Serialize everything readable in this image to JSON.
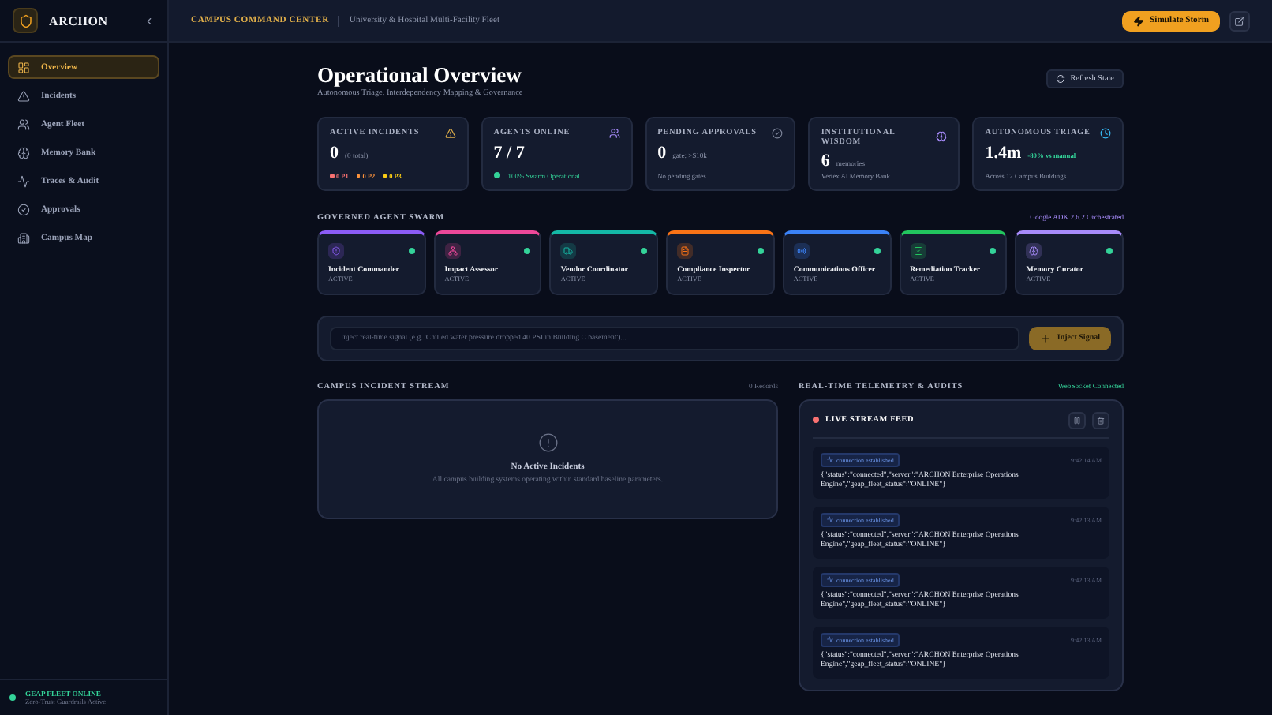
{
  "sidebar": {
    "brand": "ARCHON",
    "items": [
      {
        "label": "Overview",
        "selected": true
      },
      {
        "label": "Incidents",
        "selected": false
      },
      {
        "label": "Agent Fleet",
        "selected": false
      },
      {
        "label": "Memory Bank",
        "selected": false
      },
      {
        "label": "Traces & Audit",
        "selected": false
      },
      {
        "label": "Approvals",
        "selected": false
      },
      {
        "label": "Campus Map",
        "selected": false
      }
    ],
    "status": {
      "title": "GEAP FLEET ONLINE",
      "subtitle": "Zero-Trust Guardrails Active"
    }
  },
  "header": {
    "title": "CAMPUS COMMAND CENTER",
    "subtitle": "University & Hospital Multi-Facility Fleet",
    "action": "Simulate Storm"
  },
  "page": {
    "title": "Operational Overview",
    "subtitle": "Autonomous Triage, Interdependency Mapping & Governance",
    "refresh": "Refresh State"
  },
  "stats": [
    {
      "kind": "priorities",
      "title": "ACTIVE INCIDENTS",
      "value": "0",
      "unit": "(0 total)",
      "priorities": [
        {
          "label": "0 P1",
          "color": "#f87171"
        },
        {
          "label": "0 P2",
          "color": "#fb923c"
        },
        {
          "label": "0 P3",
          "color": "#facc15"
        }
      ]
    },
    {
      "kind": "status",
      "title": "AGENTS ONLINE",
      "value": "7 / 7",
      "note": "100% Swarm Operational"
    },
    {
      "kind": "note",
      "title": "PENDING APPROVALS",
      "value": "0",
      "unit": "gate: >$10k",
      "note": "No pending gates"
    },
    {
      "kind": "note",
      "title": "INSTITUTIONAL WISDOM",
      "value": "6",
      "unit": "memories",
      "note": "Vertex AI Memory Bank"
    },
    {
      "kind": "trend",
      "title": "AUTONOMOUS TRIAGE",
      "value": "1.4m",
      "badge": "-80% vs manual",
      "note": "Across 12 Campus Buildings"
    }
  ],
  "swarm": {
    "title": "GOVERNED AGENT SWARM",
    "tag": "Google ADK 2.6.2 Orchestrated",
    "agents": [
      {
        "name": "Incident Commander",
        "status": "ACTIVE",
        "online": true,
        "color": "#8b5cf6"
      },
      {
        "name": "Impact Assessor",
        "status": "ACTIVE",
        "online": true,
        "color": "#ec4899"
      },
      {
        "name": "Vendor Coordinator",
        "status": "ACTIVE",
        "online": true,
        "color": "#14b8a6"
      },
      {
        "name": "Compliance Inspector",
        "status": "ACTIVE",
        "online": true,
        "color": "#f97316"
      },
      {
        "name": "Communications Officer",
        "status": "ACTIVE",
        "online": true,
        "color": "#3b82f6"
      },
      {
        "name": "Remediation Tracker",
        "status": "ACTIVE",
        "online": true,
        "color": "#22c55e"
      },
      {
        "name": "Memory Curator",
        "status": "ACTIVE",
        "online": true,
        "color": "#a78bfa"
      }
    ]
  },
  "signal": {
    "placeholder": "Inject real-time signal (e.g. 'Chilled water pressure dropped 40 PSI in Building C basement')...",
    "button": "Inject Signal"
  },
  "incidents": {
    "title": "CAMPUS INCIDENT STREAM",
    "count": "0 Records",
    "empty_title": "No Active Incidents",
    "empty_text": "All campus building systems operating within standard baseline parameters."
  },
  "telemetry": {
    "title": "REAL-TIME TELEMETRY & AUDITS",
    "status": "WebSocket Connected",
    "feed_title": "LIVE STREAM FEED",
    "events": [
      {
        "type": "connection.established",
        "time": "9:42:14 AM",
        "payload": "{\"status\":\"connected\",\"server\":\"ARCHON Enterprise Operations Engine\",\"geap_fleet_status\":\"ONLINE\"}"
      },
      {
        "type": "connection.established",
        "time": "9:42:13 AM",
        "payload": "{\"status\":\"connected\",\"server\":\"ARCHON Enterprise Operations Engine\",\"geap_fleet_status\":\"ONLINE\"}"
      },
      {
        "type": "connection.established",
        "time": "9:42:13 AM",
        "payload": "{\"status\":\"connected\",\"server\":\"ARCHON Enterprise Operations Engine\",\"geap_fleet_status\":\"ONLINE\"}"
      },
      {
        "type": "connection.established",
        "time": "9:42:13 AM",
        "payload": "{\"status\":\"connected\",\"server\":\"ARCHON Enterprise Operations Engine\",\"geap_fleet_status\":\"ONLINE\"}"
      }
    ]
  }
}
